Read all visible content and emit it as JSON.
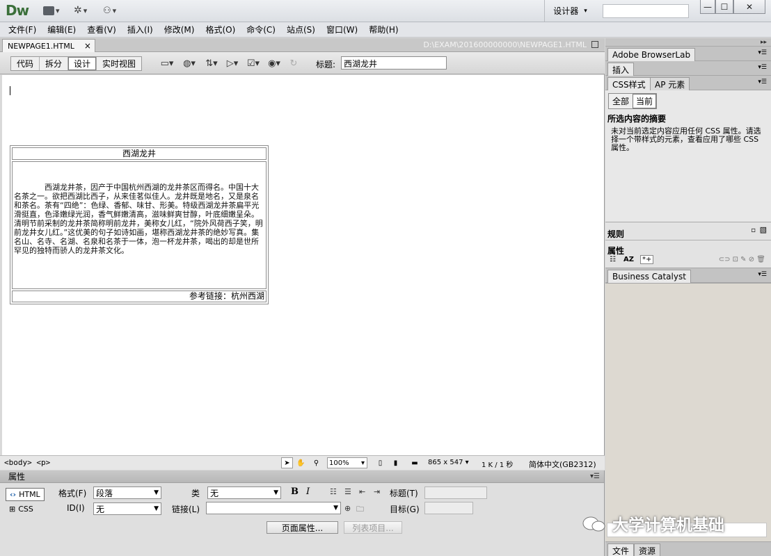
{
  "app": {
    "logo": "Dw",
    "workspace": "设计器",
    "min": "—",
    "max": "☐",
    "close": "✕"
  },
  "menu": [
    "文件(F)",
    "编辑(E)",
    "查看(V)",
    "插入(I)",
    "修改(M)",
    "格式(O)",
    "命令(C)",
    "站点(S)",
    "窗口(W)",
    "帮助(H)"
  ],
  "document": {
    "tab": "NEWPAGE1.HTML",
    "tab_close": "×",
    "path": "D:\\EXAM\\201600000000\\NEWPAGE1.HTML",
    "views": [
      "代码",
      "拆分",
      "设计",
      "实时视图"
    ],
    "active_view": "设计",
    "title_label": "标题:",
    "title_value": "西湖龙井"
  },
  "content": {
    "table_title": "西湖龙井",
    "body": "西湖龙井茶，因产于中国杭州西湖的龙井茶区而得名。中国十大名茶之一。欲把西湖比西子，从来佳茗似佳人。龙井既是地名，又是泉名和茶名。茶有“四绝”：色绿、香郁、味甘、形美。特级西湖龙井茶扁平光滑挺直，色泽嫩绿光润，香气鲜嫩清高，滋味鲜爽甘醇，叶底细嫩呈朵。清明节前采制的龙井茶简称明前龙井，美称女儿红，“院外风荷西子笑，明前龙井女儿红。”这优美的句子如诗如画，堪称西湖龙井茶的绝妙写真。集名山、名寺、名湖、名泉和名茶于一体，泡一杯龙井茶，喝出的却是世所罕见的独特而骄人的龙井茶文化。",
    "ref_link": "参考链接：杭州西湖"
  },
  "status": {
    "tag_selector": "<body> <p>",
    "zoom": "100%",
    "size": "865 x 547",
    "download": "1 K / 1 秒",
    "encoding": "简体中文(GB2312)"
  },
  "properties": {
    "title": "属性",
    "html_btn": "HTML",
    "css_btn": "CSS",
    "format_label": "格式(F)",
    "format_value": "段落",
    "class_label": "类",
    "class_value": "无",
    "id_label": "ID(I)",
    "id_value": "无",
    "link_label": "链接(L)",
    "title_label": "标题(T)",
    "target_label": "目标(G)",
    "bold": "B",
    "italic": "I",
    "page_props": "页面属性...",
    "list_item": "列表项目..."
  },
  "panels": {
    "browserlab": "Adobe BrowserLab",
    "insert": "插入",
    "css_tab": "CSS样式",
    "ap_tab": "AP 元素",
    "all": "全部",
    "current": "当前",
    "summary_title": "所选内容的摘要",
    "summary_text": "未对当前选定内容应用任何 CSS 属性。请选择一个带样式的元素，查看应用了哪些 CSS 属性。",
    "rules": "规则",
    "props": "属性",
    "business": "Business Catalyst",
    "files": "文件",
    "assets": "资源"
  },
  "watermark": "大学计算机基础"
}
